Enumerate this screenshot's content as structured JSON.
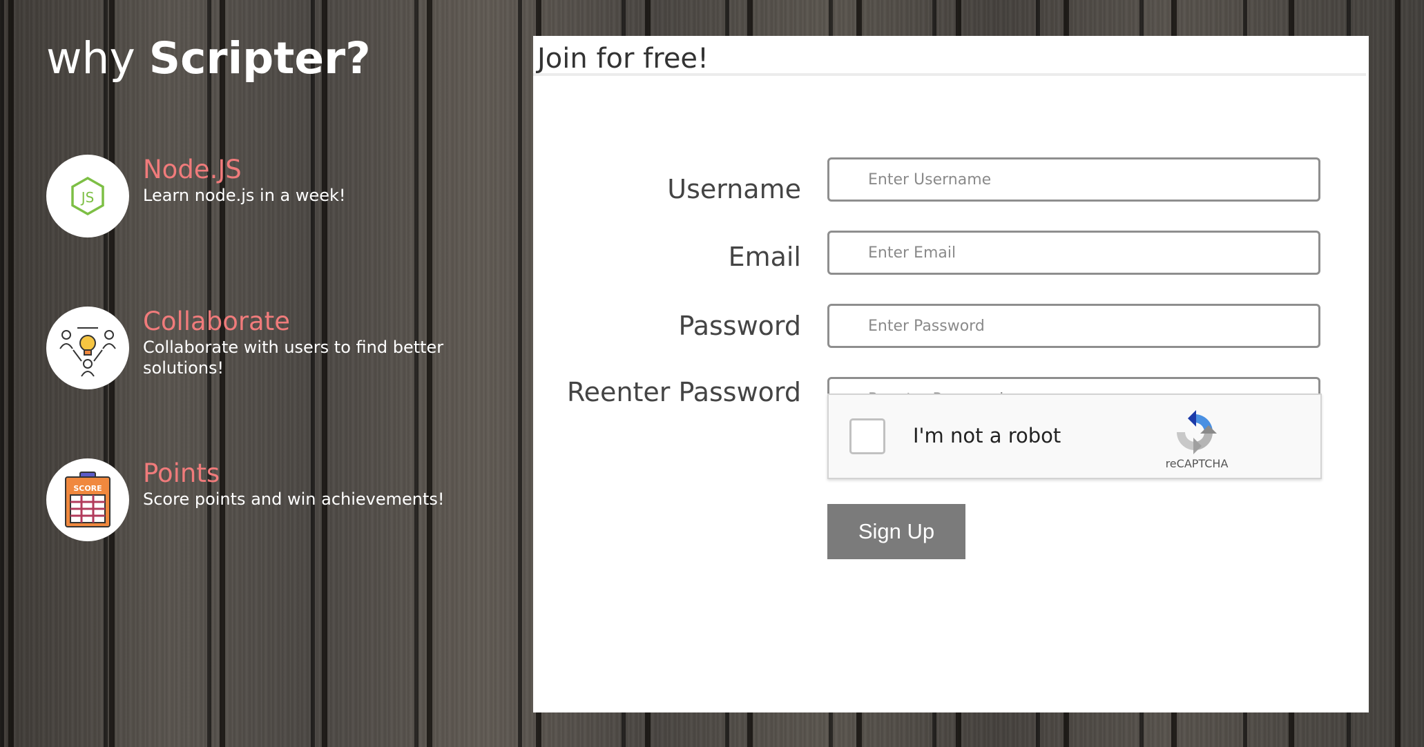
{
  "left": {
    "headline_prefix": "why",
    "headline_brand": "Scripter?",
    "features": [
      {
        "icon": "nodejs-icon",
        "title": "Node.JS",
        "description": "Learn node.js in a week!"
      },
      {
        "icon": "collaborate-icon",
        "title": "Collaborate",
        "description": "Collaborate with users to find better solutions!"
      },
      {
        "icon": "score-board-icon",
        "title": "Points",
        "description": "Score points and win achievements!"
      }
    ],
    "accent_color": "#f07b7b"
  },
  "form": {
    "title": "Join for free!",
    "fields": [
      {
        "label": "Username",
        "placeholder": "Enter Username",
        "value": ""
      },
      {
        "label": "Email",
        "placeholder": "Enter Email",
        "value": ""
      },
      {
        "label": "Password",
        "placeholder": "Enter Password",
        "value": ""
      },
      {
        "label": "Reenter Password",
        "placeholder": "Reenter Password",
        "value": ""
      }
    ],
    "captcha": {
      "text": "I'm not a robot",
      "brand": "reCAPTCHA",
      "icon": "recaptcha-icon"
    },
    "submit_label": "Sign Up",
    "button_color": "#7b7b7b"
  }
}
